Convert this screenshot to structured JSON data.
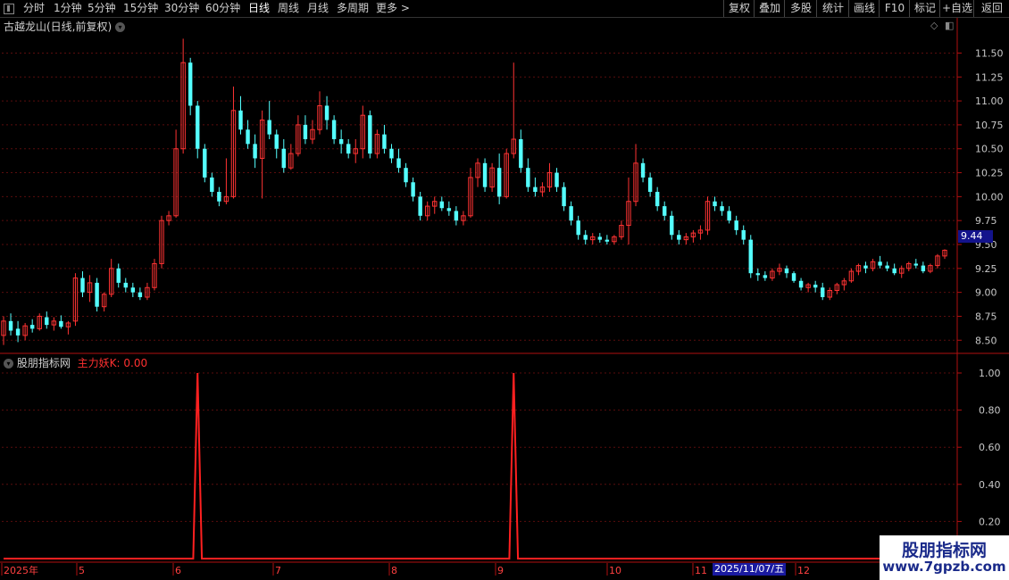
{
  "toolbar": {
    "periods": [
      "分时",
      "1分钟",
      "5分钟",
      "15分钟",
      "30分钟",
      "60分钟",
      "日线",
      "周线",
      "月线",
      "多周期",
      "更多 >"
    ],
    "active_period": "日线",
    "right_buttons": [
      "复权",
      "叠加",
      "多股",
      "统计",
      "画线",
      "F10",
      "标记",
      "+自选",
      "返回"
    ]
  },
  "main_chart": {
    "title": "古越龙山(日线,前复权)",
    "current_price": "9.44",
    "y_ticks": [
      "11.50",
      "11.25",
      "11.00",
      "10.75",
      "10.50",
      "10.25",
      "10.00",
      "9.75",
      "9.50",
      "9.25",
      "9.00",
      "8.75",
      "8.50"
    ]
  },
  "indicator": {
    "name": "股朋指标网",
    "value_label": "主力妖K: 0.00",
    "y_ticks": [
      "1.00",
      "0.80",
      "0.60",
      "0.40",
      "0.20"
    ]
  },
  "date_axis": {
    "labels": [
      "2025年",
      "5",
      "6",
      "7",
      "8",
      "9",
      "10",
      "11",
      "12"
    ],
    "highlight": "2025/11/07/五"
  },
  "watermark": {
    "line1": "股朋指标网",
    "line2": "www.7gpzb.com"
  },
  "colors": {
    "up": "#ff3333",
    "down": "#54ffff",
    "signal": "#ff2020",
    "price_tag_bg": "#13138c"
  },
  "chart_data": {
    "type": "candlestick",
    "ylim": [
      8.4,
      11.7
    ],
    "candles": [
      [
        8.55,
        8.75,
        8.45,
        8.7
      ],
      [
        8.7,
        8.78,
        8.55,
        8.6
      ],
      [
        8.62,
        8.7,
        8.48,
        8.55
      ],
      [
        8.55,
        8.68,
        8.5,
        8.65
      ],
      [
        8.66,
        8.72,
        8.58,
        8.62
      ],
      [
        8.62,
        8.78,
        8.6,
        8.75
      ],
      [
        8.74,
        8.8,
        8.62,
        8.66
      ],
      [
        8.66,
        8.74,
        8.6,
        8.7
      ],
      [
        8.7,
        8.76,
        8.62,
        8.64
      ],
      [
        8.64,
        8.7,
        8.56,
        8.68
      ],
      [
        8.7,
        9.2,
        8.65,
        9.15
      ],
      [
        9.15,
        9.22,
        8.95,
        9.0
      ],
      [
        9.0,
        9.18,
        8.9,
        9.1
      ],
      [
        9.1,
        9.15,
        8.8,
        8.85
      ],
      [
        8.85,
        9.0,
        8.8,
        8.98
      ],
      [
        8.98,
        9.35,
        8.95,
        9.25
      ],
      [
        9.25,
        9.3,
        9.05,
        9.1
      ],
      [
        9.1,
        9.15,
        9.0,
        9.05
      ],
      [
        9.05,
        9.1,
        8.95,
        9.0
      ],
      [
        9.0,
        9.05,
        8.92,
        8.95
      ],
      [
        8.95,
        9.1,
        8.92,
        9.05
      ],
      [
        9.05,
        9.35,
        9.02,
        9.3
      ],
      [
        9.3,
        9.8,
        9.25,
        9.75
      ],
      [
        9.75,
        9.85,
        9.7,
        9.8
      ],
      [
        9.8,
        10.7,
        9.78,
        10.5
      ],
      [
        10.5,
        11.65,
        10.45,
        11.4
      ],
      [
        11.4,
        11.45,
        10.85,
        10.95
      ],
      [
        10.95,
        11.0,
        10.4,
        10.5
      ],
      [
        10.5,
        10.55,
        10.15,
        10.2
      ],
      [
        10.2,
        10.25,
        10.0,
        10.05
      ],
      [
        10.05,
        10.1,
        9.9,
        9.95
      ],
      [
        9.95,
        10.4,
        9.92,
        10.0
      ],
      [
        10.0,
        11.15,
        9.98,
        10.9
      ],
      [
        10.9,
        11.05,
        10.65,
        10.7
      ],
      [
        10.7,
        10.8,
        10.5,
        10.55
      ],
      [
        10.55,
        10.65,
        10.3,
        10.4
      ],
      [
        10.4,
        10.9,
        9.98,
        10.8
      ],
      [
        10.8,
        11.0,
        10.6,
        10.65
      ],
      [
        10.65,
        10.7,
        10.4,
        10.5
      ],
      [
        10.5,
        10.6,
        10.25,
        10.3
      ],
      [
        10.3,
        10.55,
        10.28,
        10.45
      ],
      [
        10.45,
        10.85,
        10.42,
        10.75
      ],
      [
        10.75,
        10.85,
        10.55,
        10.6
      ],
      [
        10.6,
        10.8,
        10.55,
        10.7
      ],
      [
        10.7,
        11.1,
        10.65,
        10.95
      ],
      [
        10.95,
        11.05,
        10.7,
        10.8
      ],
      [
        10.8,
        10.85,
        10.55,
        10.6
      ],
      [
        10.6,
        10.7,
        10.45,
        10.55
      ],
      [
        10.55,
        10.6,
        10.4,
        10.45
      ],
      [
        10.45,
        10.6,
        10.35,
        10.5
      ],
      [
        10.5,
        10.95,
        10.4,
        10.85
      ],
      [
        10.85,
        10.9,
        10.4,
        10.45
      ],
      [
        10.45,
        10.7,
        10.4,
        10.65
      ],
      [
        10.65,
        10.75,
        10.45,
        10.5
      ],
      [
        10.5,
        10.55,
        10.35,
        10.4
      ],
      [
        10.4,
        10.5,
        10.25,
        10.3
      ],
      [
        10.3,
        10.35,
        10.1,
        10.15
      ],
      [
        10.15,
        10.2,
        9.95,
        10.0
      ],
      [
        10.0,
        10.05,
        9.75,
        9.8
      ],
      [
        9.8,
        9.95,
        9.75,
        9.9
      ],
      [
        9.9,
        10.0,
        9.82,
        9.95
      ],
      [
        9.95,
        10.0,
        9.85,
        9.88
      ],
      [
        9.88,
        9.95,
        9.8,
        9.85
      ],
      [
        9.85,
        9.9,
        9.7,
        9.75
      ],
      [
        9.75,
        9.85,
        9.7,
        9.8
      ],
      [
        9.8,
        10.3,
        9.78,
        10.2
      ],
      [
        10.2,
        10.4,
        10.1,
        10.35
      ],
      [
        10.35,
        10.4,
        10.05,
        10.1
      ],
      [
        10.1,
        10.35,
        10.05,
        10.3
      ],
      [
        10.3,
        10.45,
        9.92,
        10.0
      ],
      [
        10.0,
        10.5,
        9.98,
        10.45
      ],
      [
        10.45,
        11.4,
        10.4,
        10.6
      ],
      [
        10.6,
        10.7,
        10.25,
        10.3
      ],
      [
        10.3,
        10.4,
        10.05,
        10.1
      ],
      [
        10.1,
        10.2,
        10.0,
        10.05
      ],
      [
        10.05,
        10.15,
        10.0,
        10.1
      ],
      [
        10.1,
        10.35,
        10.05,
        10.25
      ],
      [
        10.25,
        10.3,
        10.05,
        10.1
      ],
      [
        10.1,
        10.15,
        9.85,
        9.9
      ],
      [
        9.9,
        9.95,
        9.7,
        9.75
      ],
      [
        9.75,
        9.8,
        9.55,
        9.6
      ],
      [
        9.6,
        9.65,
        9.5,
        9.55
      ],
      [
        9.55,
        9.62,
        9.5,
        9.58
      ],
      [
        9.58,
        9.62,
        9.52,
        9.55
      ],
      [
        9.55,
        9.6,
        9.5,
        9.53
      ],
      [
        9.53,
        9.6,
        9.5,
        9.58
      ],
      [
        9.58,
        9.75,
        9.55,
        9.7
      ],
      [
        9.7,
        10.2,
        9.5,
        9.95
      ],
      [
        9.95,
        10.55,
        9.9,
        10.35
      ],
      [
        10.35,
        10.4,
        10.15,
        10.2
      ],
      [
        10.2,
        10.25,
        10.0,
        10.05
      ],
      [
        10.05,
        10.1,
        9.85,
        9.9
      ],
      [
        9.9,
        9.95,
        9.75,
        9.8
      ],
      [
        9.8,
        9.85,
        9.55,
        9.6
      ],
      [
        9.6,
        9.65,
        9.5,
        9.55
      ],
      [
        9.55,
        9.62,
        9.5,
        9.58
      ],
      [
        9.58,
        9.65,
        9.52,
        9.62
      ],
      [
        9.62,
        9.7,
        9.55,
        9.65
      ],
      [
        9.65,
        10.0,
        9.6,
        9.95
      ],
      [
        9.95,
        10.0,
        9.85,
        9.9
      ],
      [
        9.9,
        9.95,
        9.8,
        9.85
      ],
      [
        9.85,
        9.9,
        9.72,
        9.75
      ],
      [
        9.75,
        9.8,
        9.6,
        9.65
      ],
      [
        9.65,
        9.7,
        9.5,
        9.55
      ],
      [
        9.55,
        9.6,
        9.15,
        9.2
      ],
      [
        9.2,
        9.25,
        9.12,
        9.18
      ],
      [
        9.18,
        9.22,
        9.12,
        9.15
      ],
      [
        9.15,
        9.25,
        9.12,
        9.22
      ],
      [
        9.22,
        9.3,
        9.18,
        9.25
      ],
      [
        9.25,
        9.28,
        9.15,
        9.2
      ],
      [
        9.2,
        9.22,
        9.1,
        9.12
      ],
      [
        9.12,
        9.15,
        9.02,
        9.05
      ],
      [
        9.05,
        9.1,
        9.0,
        9.08
      ],
      [
        9.08,
        9.12,
        9.0,
        9.05
      ],
      [
        9.05,
        9.1,
        8.92,
        8.95
      ],
      [
        8.95,
        9.05,
        8.92,
        9.02
      ],
      [
        9.02,
        9.1,
        8.98,
        9.08
      ],
      [
        9.08,
        9.15,
        9.02,
        9.12
      ],
      [
        9.12,
        9.25,
        9.1,
        9.22
      ],
      [
        9.22,
        9.3,
        9.18,
        9.28
      ],
      [
        9.28,
        9.32,
        9.2,
        9.25
      ],
      [
        9.25,
        9.35,
        9.22,
        9.32
      ],
      [
        9.32,
        9.38,
        9.25,
        9.28
      ],
      [
        9.28,
        9.32,
        9.22,
        9.25
      ],
      [
        9.25,
        9.3,
        9.18,
        9.2
      ],
      [
        9.2,
        9.28,
        9.15,
        9.25
      ],
      [
        9.25,
        9.32,
        9.22,
        9.3
      ],
      [
        9.3,
        9.35,
        9.25,
        9.28
      ],
      [
        9.28,
        9.32,
        9.2,
        9.22
      ],
      [
        9.22,
        9.3,
        9.2,
        9.28
      ],
      [
        9.28,
        9.4,
        9.25,
        9.38
      ],
      [
        9.38,
        9.45,
        9.35,
        9.44
      ]
    ],
    "signal_spikes": [
      {
        "candle_index": 27,
        "value": 1.0
      },
      {
        "candle_index": 71,
        "value": 1.0
      }
    ]
  }
}
